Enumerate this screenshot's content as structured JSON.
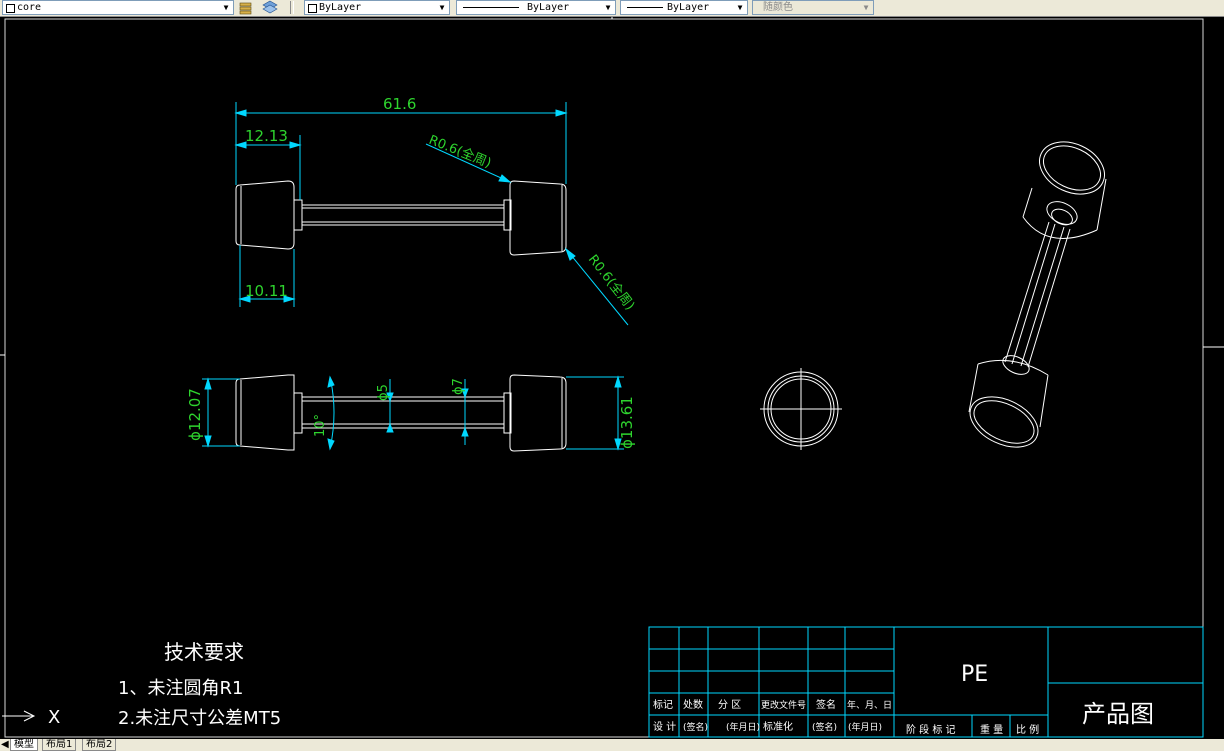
{
  "toolbar": {
    "layer_value": "core",
    "color_value": "ByLayer",
    "linetype_value": "ByLayer",
    "lineweight_value": "ByLayer",
    "plotstyle_value": "随颜色"
  },
  "drawing": {
    "front_view": {
      "overall_length": "61.6",
      "left_cap_top": "12.13",
      "left_cap_bottom": "10.11",
      "fillet_top": "R0.6(全周)",
      "fillet_right": "R0.6(全周)"
    },
    "section_view": {
      "left_diameter": "ϕ12.07",
      "taper_angle": "10°",
      "shaft_small": "ϕ5",
      "shaft_large": "ϕ7",
      "right_diameter": "ϕ13.61"
    },
    "notes": {
      "title": "技术要求",
      "line1": "1、未注圆角R1",
      "line2": "2.未注尺寸公差MT5"
    },
    "ucs_label": "X"
  },
  "title_block": {
    "material": "PE",
    "drawing_name": "产品图",
    "row_labels": [
      "标记",
      "处数",
      "分 区",
      "更改文件号",
      "签名",
      "年、月、日"
    ],
    "row_labels2": [
      "设 计",
      "(签名)",
      "(年月日)",
      "标准化",
      "(签名)",
      "(年月日)"
    ],
    "stage_labels": [
      "阶 段 标 记",
      "重 量",
      "比 例"
    ]
  },
  "tabs": [
    {
      "label": "模型"
    },
    {
      "label": "布局1"
    },
    {
      "label": "布局2"
    }
  ]
}
